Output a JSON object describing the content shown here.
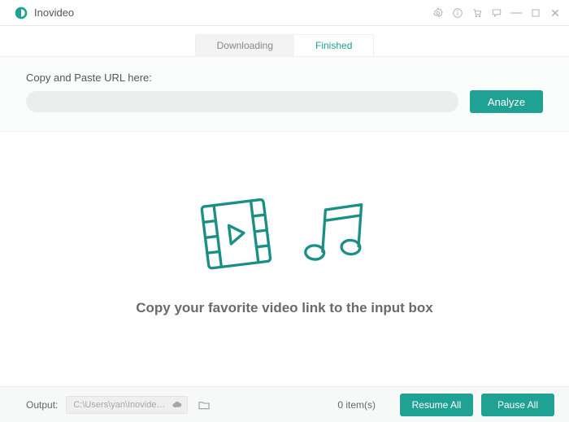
{
  "app": {
    "name": "Inovideo"
  },
  "tabs": {
    "downloading": "Downloading",
    "finished": "Finished"
  },
  "urlPanel": {
    "label": "Copy and Paste URL here:",
    "inputValue": "",
    "analyze": "Analyze"
  },
  "main": {
    "hint": "Copy your favorite video link to the input box"
  },
  "footer": {
    "outputLabel": "Output:",
    "outputPath": "C:\\Users\\yan\\Inovideo\\D...",
    "itemCount": "0 item(s)",
    "resumeAll": "Resume All",
    "pauseAll": "Pause All"
  },
  "colors": {
    "accent": "#1fa193"
  }
}
